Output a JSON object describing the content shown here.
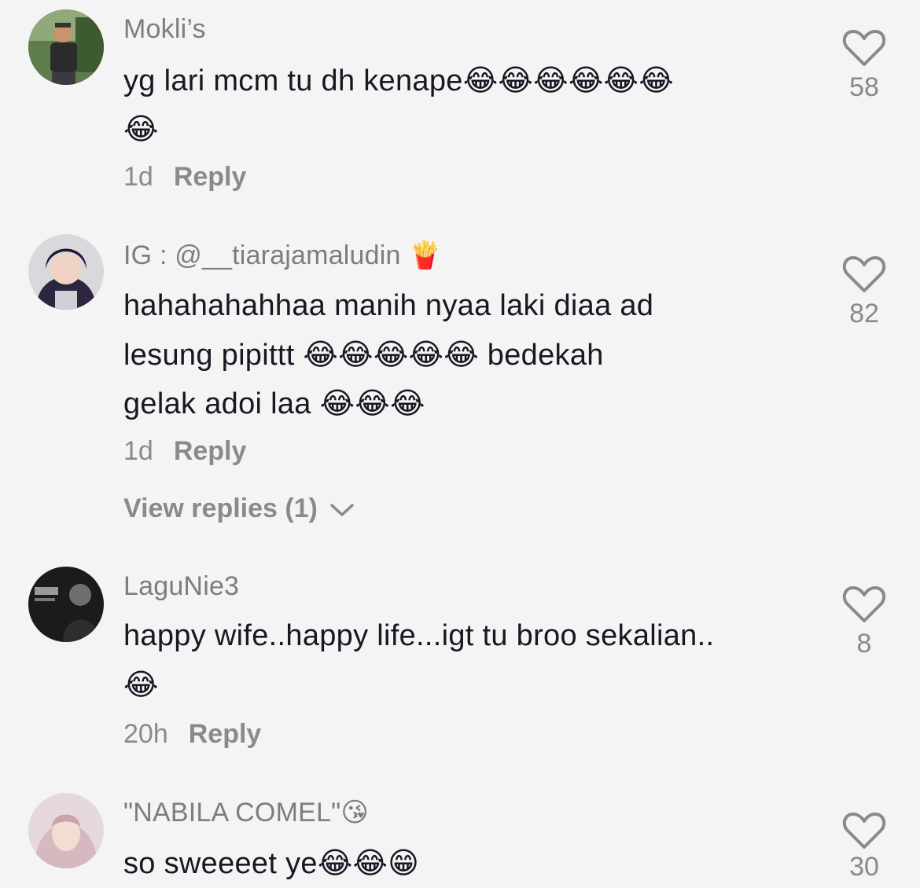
{
  "comments": [
    {
      "username": "Mokli’s",
      "lines": [
        "yg lari mcm tu dh kenape😂😂😂😂😂😂",
        "😂"
      ],
      "time": "1d",
      "reply_label": "Reply",
      "likes": "58",
      "avatar": "man-outdoor-avatar"
    },
    {
      "username": "IG : @__tiarajamaludin 🍟",
      "lines": [
        "hahahahahhaa manih nyaa laki diaa ad",
        "lesung pipittt 😂😂😂😂😂 bedekah",
        "gelak adoi laa 😂😂😂"
      ],
      "time": "1d",
      "reply_label": "Reply",
      "likes": "82",
      "view_replies": "View replies (1)",
      "avatar": "girl-avatar"
    },
    {
      "username": "LaguNie3",
      "lines": [
        "happy wife..happy life...igt tu broo sekalian..",
        "😂"
      ],
      "time": "20h",
      "reply_label": "Reply",
      "likes": "8",
      "avatar": "dbz-skincare-avatar"
    },
    {
      "username": "\"NABILA COMEL\"😘",
      "lines": [
        "so sweeeet ye😂😂😁"
      ],
      "likes": "30",
      "avatar": "woman-hijab-avatar"
    }
  ],
  "colors": {
    "background": "#f4f4f4",
    "text": "#161823",
    "muted": "#8a8a8e"
  }
}
